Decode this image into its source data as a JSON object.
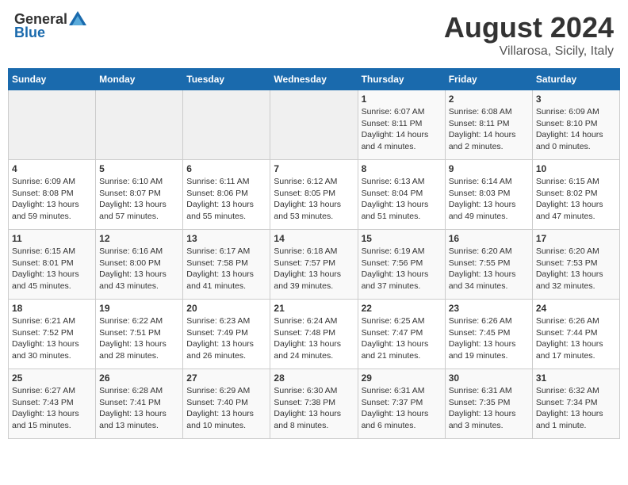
{
  "header": {
    "logo_general": "General",
    "logo_blue": "Blue",
    "title": "August 2024",
    "location": "Villarosa, Sicily, Italy"
  },
  "days_of_week": [
    "Sunday",
    "Monday",
    "Tuesday",
    "Wednesday",
    "Thursday",
    "Friday",
    "Saturday"
  ],
  "weeks": [
    [
      {
        "day": "",
        "info": ""
      },
      {
        "day": "",
        "info": ""
      },
      {
        "day": "",
        "info": ""
      },
      {
        "day": "",
        "info": ""
      },
      {
        "day": "1",
        "info": "Sunrise: 6:07 AM\nSunset: 8:11 PM\nDaylight: 14 hours\nand 4 minutes."
      },
      {
        "day": "2",
        "info": "Sunrise: 6:08 AM\nSunset: 8:11 PM\nDaylight: 14 hours\nand 2 minutes."
      },
      {
        "day": "3",
        "info": "Sunrise: 6:09 AM\nSunset: 8:10 PM\nDaylight: 14 hours\nand 0 minutes."
      }
    ],
    [
      {
        "day": "4",
        "info": "Sunrise: 6:09 AM\nSunset: 8:08 PM\nDaylight: 13 hours\nand 59 minutes."
      },
      {
        "day": "5",
        "info": "Sunrise: 6:10 AM\nSunset: 8:07 PM\nDaylight: 13 hours\nand 57 minutes."
      },
      {
        "day": "6",
        "info": "Sunrise: 6:11 AM\nSunset: 8:06 PM\nDaylight: 13 hours\nand 55 minutes."
      },
      {
        "day": "7",
        "info": "Sunrise: 6:12 AM\nSunset: 8:05 PM\nDaylight: 13 hours\nand 53 minutes."
      },
      {
        "day": "8",
        "info": "Sunrise: 6:13 AM\nSunset: 8:04 PM\nDaylight: 13 hours\nand 51 minutes."
      },
      {
        "day": "9",
        "info": "Sunrise: 6:14 AM\nSunset: 8:03 PM\nDaylight: 13 hours\nand 49 minutes."
      },
      {
        "day": "10",
        "info": "Sunrise: 6:15 AM\nSunset: 8:02 PM\nDaylight: 13 hours\nand 47 minutes."
      }
    ],
    [
      {
        "day": "11",
        "info": "Sunrise: 6:15 AM\nSunset: 8:01 PM\nDaylight: 13 hours\nand 45 minutes."
      },
      {
        "day": "12",
        "info": "Sunrise: 6:16 AM\nSunset: 8:00 PM\nDaylight: 13 hours\nand 43 minutes."
      },
      {
        "day": "13",
        "info": "Sunrise: 6:17 AM\nSunset: 7:58 PM\nDaylight: 13 hours\nand 41 minutes."
      },
      {
        "day": "14",
        "info": "Sunrise: 6:18 AM\nSunset: 7:57 PM\nDaylight: 13 hours\nand 39 minutes."
      },
      {
        "day": "15",
        "info": "Sunrise: 6:19 AM\nSunset: 7:56 PM\nDaylight: 13 hours\nand 37 minutes."
      },
      {
        "day": "16",
        "info": "Sunrise: 6:20 AM\nSunset: 7:55 PM\nDaylight: 13 hours\nand 34 minutes."
      },
      {
        "day": "17",
        "info": "Sunrise: 6:20 AM\nSunset: 7:53 PM\nDaylight: 13 hours\nand 32 minutes."
      }
    ],
    [
      {
        "day": "18",
        "info": "Sunrise: 6:21 AM\nSunset: 7:52 PM\nDaylight: 13 hours\nand 30 minutes."
      },
      {
        "day": "19",
        "info": "Sunrise: 6:22 AM\nSunset: 7:51 PM\nDaylight: 13 hours\nand 28 minutes."
      },
      {
        "day": "20",
        "info": "Sunrise: 6:23 AM\nSunset: 7:49 PM\nDaylight: 13 hours\nand 26 minutes."
      },
      {
        "day": "21",
        "info": "Sunrise: 6:24 AM\nSunset: 7:48 PM\nDaylight: 13 hours\nand 24 minutes."
      },
      {
        "day": "22",
        "info": "Sunrise: 6:25 AM\nSunset: 7:47 PM\nDaylight: 13 hours\nand 21 minutes."
      },
      {
        "day": "23",
        "info": "Sunrise: 6:26 AM\nSunset: 7:45 PM\nDaylight: 13 hours\nand 19 minutes."
      },
      {
        "day": "24",
        "info": "Sunrise: 6:26 AM\nSunset: 7:44 PM\nDaylight: 13 hours\nand 17 minutes."
      }
    ],
    [
      {
        "day": "25",
        "info": "Sunrise: 6:27 AM\nSunset: 7:43 PM\nDaylight: 13 hours\nand 15 minutes."
      },
      {
        "day": "26",
        "info": "Sunrise: 6:28 AM\nSunset: 7:41 PM\nDaylight: 13 hours\nand 13 minutes."
      },
      {
        "day": "27",
        "info": "Sunrise: 6:29 AM\nSunset: 7:40 PM\nDaylight: 13 hours\nand 10 minutes."
      },
      {
        "day": "28",
        "info": "Sunrise: 6:30 AM\nSunset: 7:38 PM\nDaylight: 13 hours\nand 8 minutes."
      },
      {
        "day": "29",
        "info": "Sunrise: 6:31 AM\nSunset: 7:37 PM\nDaylight: 13 hours\nand 6 minutes."
      },
      {
        "day": "30",
        "info": "Sunrise: 6:31 AM\nSunset: 7:35 PM\nDaylight: 13 hours\nand 3 minutes."
      },
      {
        "day": "31",
        "info": "Sunrise: 6:32 AM\nSunset: 7:34 PM\nDaylight: 13 hours\nand 1 minute."
      }
    ]
  ]
}
